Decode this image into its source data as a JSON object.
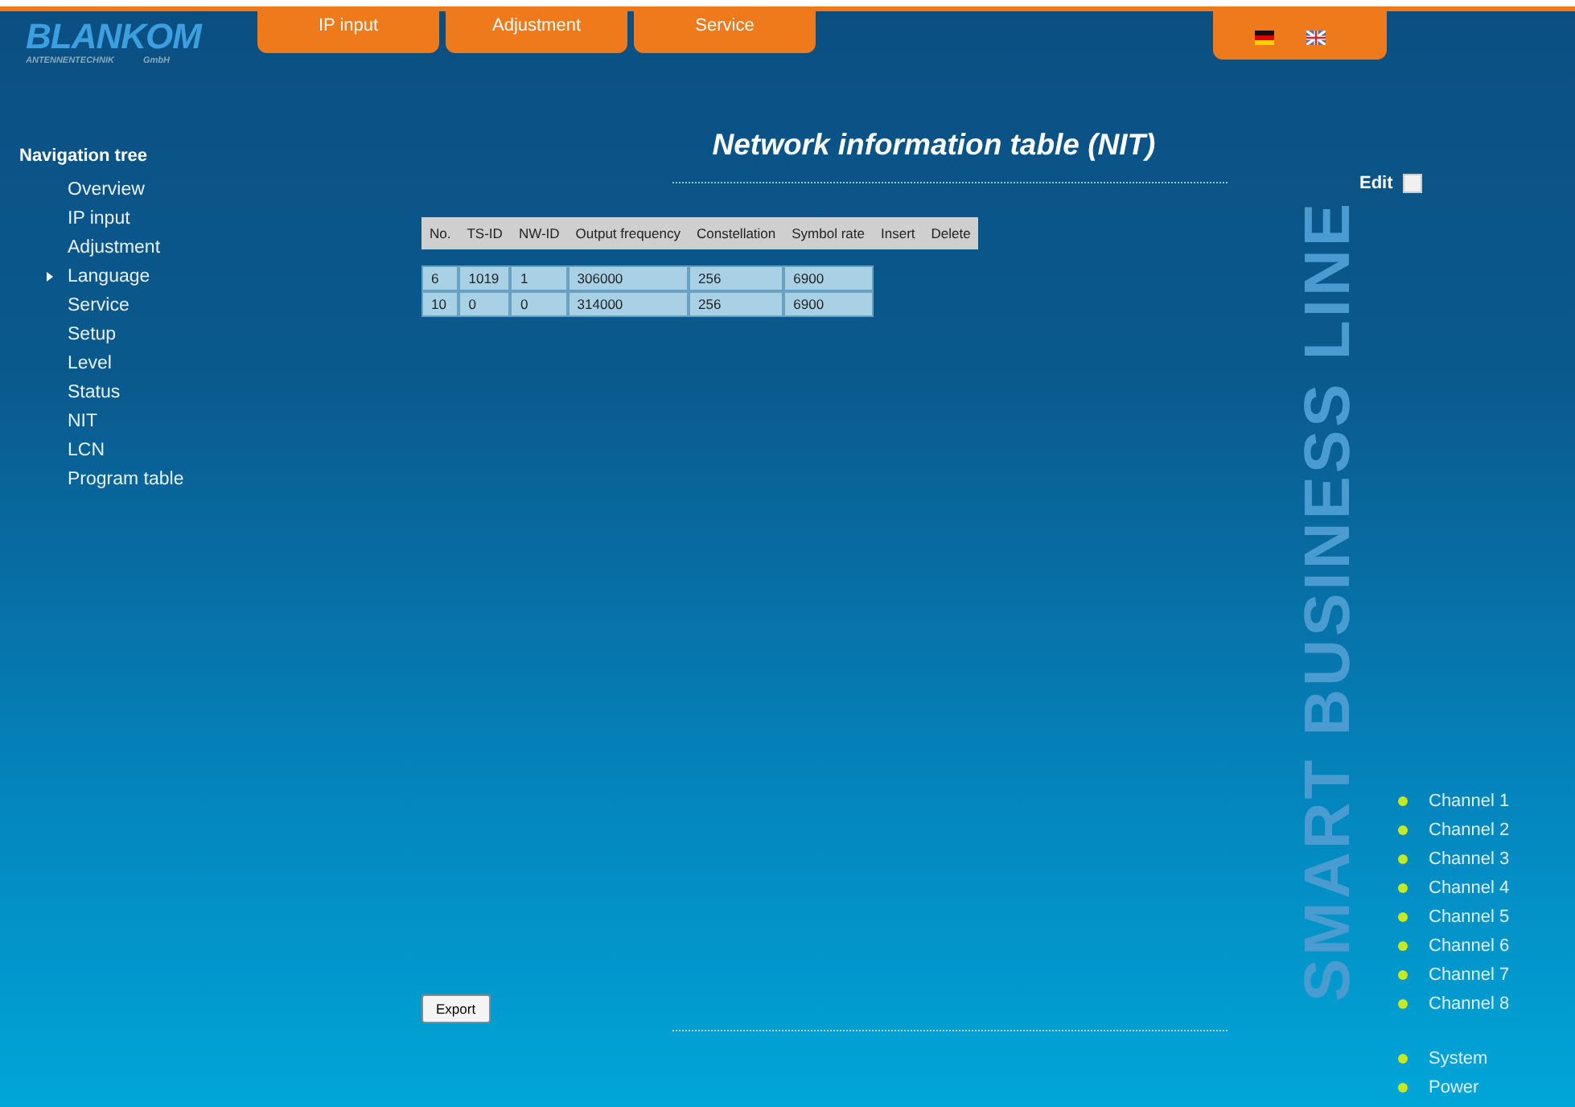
{
  "logo": {
    "name": "BLANKOM",
    "subtitle_left": "ANTENNENTECHNIK",
    "subtitle_right": "GmbH"
  },
  "tabs": [
    {
      "label": "IP input"
    },
    {
      "label": "Adjustment"
    },
    {
      "label": "Service"
    }
  ],
  "sidebar": {
    "title": "Navigation tree",
    "items": [
      {
        "label": "Overview",
        "selected": false
      },
      {
        "label": "IP input",
        "selected": false
      },
      {
        "label": "Adjustment",
        "selected": false
      },
      {
        "label": "Language",
        "selected": true
      },
      {
        "label": "Service",
        "selected": false
      },
      {
        "label": "Setup",
        "selected": false
      },
      {
        "label": "Level",
        "selected": false
      },
      {
        "label": "Status",
        "selected": false
      },
      {
        "label": "NIT",
        "selected": false
      },
      {
        "label": "LCN",
        "selected": false
      },
      {
        "label": "Program table",
        "selected": false
      }
    ]
  },
  "page_title": "Network information table (NIT)",
  "edit": {
    "label": "Edit",
    "checked": false
  },
  "table": {
    "columns": [
      "No.",
      "TS-ID",
      "NW-ID",
      "Output frequency",
      "Constellation",
      "Symbol rate",
      "Insert",
      "Delete"
    ],
    "rows": [
      [
        "6",
        "1019",
        "1",
        "306000",
        "256",
        "6900"
      ],
      [
        "10",
        "0",
        "0",
        "314000",
        "256",
        "6900"
      ]
    ]
  },
  "export_button": "Export",
  "side_slogan": "SMART BUSINESS LINE",
  "status": {
    "channels": [
      "Channel 1",
      "Channel 2",
      "Channel 3",
      "Channel 4",
      "Channel 5",
      "Channel 6",
      "Channel 7",
      "Channel 8"
    ],
    "system": [
      "System",
      "Power"
    ]
  }
}
